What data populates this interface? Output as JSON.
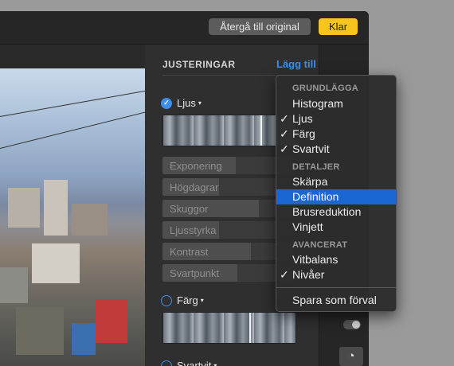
{
  "toolbar": {
    "revert_label": "Återgå till original",
    "done_label": "Klar"
  },
  "panel": {
    "heading": "JUSTERINGAR",
    "add_label": "Lägg till",
    "sections": {
      "light": {
        "label": "Ljus",
        "checked": true
      },
      "color": {
        "label": "Färg",
        "checked": false
      },
      "bw": {
        "label": "Svartvit",
        "checked": false
      }
    },
    "sliders": [
      {
        "label": "Exponering",
        "value": 0.55
      },
      {
        "label": "Högdagrar",
        "value": 0.42
      },
      {
        "label": "Skuggor",
        "value": 0.72
      },
      {
        "label": "Ljusstyrka",
        "value": 0.42
      },
      {
        "label": "Kontrast",
        "value": 0.66
      },
      {
        "label": "Svartpunkt",
        "value": 0.56
      }
    ]
  },
  "menu": {
    "groups": [
      {
        "header": "GRUNDLÄGGA",
        "items": [
          {
            "label": "Histogram",
            "checked": false
          },
          {
            "label": "Ljus",
            "checked": true
          },
          {
            "label": "Färg",
            "checked": true
          },
          {
            "label": "Svartvit",
            "checked": true
          }
        ]
      },
      {
        "header": "DETALJER",
        "items": [
          {
            "label": "Skärpa",
            "checked": false
          },
          {
            "label": "Definition",
            "checked": false,
            "highlighted": true
          },
          {
            "label": "Brusreduktion",
            "checked": false
          },
          {
            "label": "Vinjett",
            "checked": false
          }
        ]
      },
      {
        "header": "AVANCERAT",
        "items": [
          {
            "label": "Vitbalans",
            "checked": false
          },
          {
            "label": "Nivåer",
            "checked": true
          }
        ]
      }
    ],
    "save_preset": "Spara som förval",
    "check_glyph": "✓"
  },
  "icons": {
    "caret": "▾",
    "knob": "◔"
  },
  "colors": {
    "accent": "#3d8ee8",
    "done": "#f7c51b",
    "highlight": "#1a66d2"
  }
}
